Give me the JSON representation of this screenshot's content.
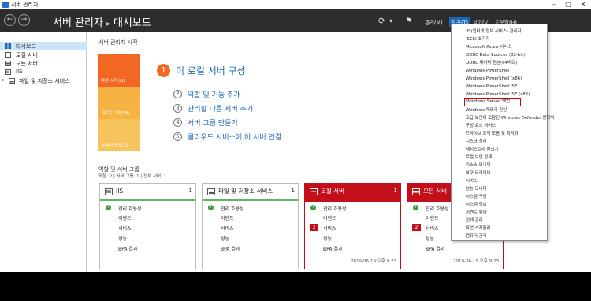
{
  "window": {
    "title": "서버 관리자"
  },
  "header": {
    "breadcrumb_root": "서버 관리자",
    "breadcrumb_page": "대시보드",
    "menus": [
      "관리(M)",
      "도구(T)",
      "보기(V)",
      "도움말(H)"
    ]
  },
  "sidebar": {
    "items": [
      {
        "label": "대시보드",
        "selected": true
      },
      {
        "label": "로컬 서버"
      },
      {
        "label": "모든 서버"
      },
      {
        "label": "IIS"
      },
      {
        "label": "파일 및 저장소 서비스"
      }
    ]
  },
  "main": {
    "welcome_title": "서버 관리자 시작",
    "tiles": [
      "빠른 시작(Q)",
      "새로운 기능(W)",
      "자세한 정보(L)"
    ],
    "steps": [
      {
        "num": "1",
        "label": "이 로컬 서버 구성"
      },
      {
        "num": "2",
        "label": "역할 및 기능 추가"
      },
      {
        "num": "3",
        "label": "관리할 다른 서버 추가"
      },
      {
        "num": "4",
        "label": "서버 그룹 만들기"
      },
      {
        "num": "5",
        "label": "클라우드 서비스에 이 서버 연결"
      }
    ],
    "roles_heading": "역할 및 서버 그룹",
    "roles_sub": "역할: 2  |  서버 그룹: 1  |  전체 서버: 1"
  },
  "cards": [
    {
      "title": "IIS",
      "count": "1",
      "alert": false,
      "rows": [
        {
          "label": "관리 효용성",
          "ok": true
        },
        {
          "label": "이벤트"
        },
        {
          "label": "서비스"
        },
        {
          "label": "성능"
        },
        {
          "label": "BPA 결과"
        }
      ],
      "timestamp": ""
    },
    {
      "title": "파일 및 저장소 서비스",
      "count": "1",
      "alert": false,
      "rows": [
        {
          "label": "관리 효용성",
          "ok": true
        },
        {
          "label": "이벤트"
        },
        {
          "label": "서비스"
        },
        {
          "label": "성능"
        },
        {
          "label": "BPA 결과"
        }
      ],
      "timestamp": ""
    },
    {
      "title": "로컬 서버",
      "count": "1",
      "alert": true,
      "rows": [
        {
          "label": "관리 효용성",
          "ok": true
        },
        {
          "label": "이벤트"
        },
        {
          "label": "서비스",
          "badge": "2"
        },
        {
          "label": "성능"
        },
        {
          "label": "BPA 결과"
        }
      ],
      "timestamp": "2019-06-19 오후 9:23"
    },
    {
      "title": "모든 서버",
      "count": "1",
      "alert": true,
      "rows": [
        {
          "label": "관리 효용성",
          "ok": true
        },
        {
          "label": "이벤트"
        },
        {
          "label": "서비스",
          "badge": "2"
        },
        {
          "label": "성능"
        },
        {
          "label": "BPA 결과"
        }
      ],
      "timestamp": "2019-06-19 오후 9:23"
    }
  ],
  "tools_menu": {
    "items": [
      "IIS(인터넷 정보 서비스) 관리자",
      "iSCSI 초기자",
      "Microsoft Azure 서비스",
      "ODBC Data Sources (32-bit)",
      "ODBC 데이터 원본(64비트)",
      "Windows PowerShell",
      "Windows PowerShell (x86)",
      "Windows PowerShell ISE",
      "Windows PowerShell ISE (x86)",
      "Windows Server 백업",
      "Windows 메모리 진단",
      "고급 보안이 포함된 Windows Defender 방화벽",
      "구성 요소 서비스",
      "드라이브 조각 모음 및 최적화",
      "디스크 정리",
      "레지스트리 편집기",
      "로컬 보안 정책",
      "리소스 모니터",
      "복구 드라이브",
      "서비스",
      "성능 모니터",
      "시스템 구성",
      "시스템 정보",
      "이벤트 뷰어",
      "인쇄 관리",
      "작업 스케줄러",
      "컴퓨터 관리"
    ],
    "highlighted_index": 9
  },
  "colors": {
    "accent": "#1a67b5",
    "alert": "#c30f1a",
    "ok": "#5cb85c",
    "header": "#2d2d2d"
  }
}
